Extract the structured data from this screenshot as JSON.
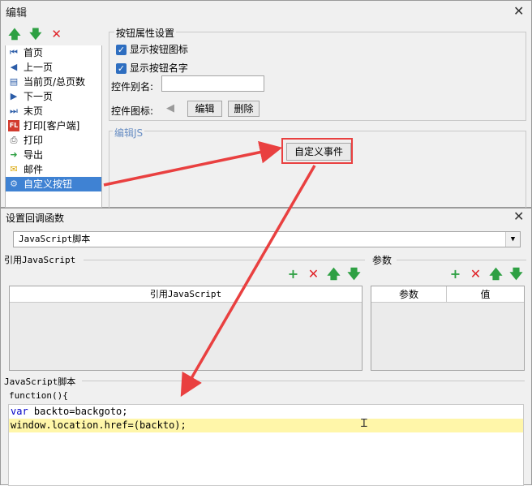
{
  "edit_dialog": {
    "title": "编辑",
    "toolbar": {
      "icons": [
        "add-up-icon",
        "move-down-icon",
        "delete-icon"
      ]
    },
    "button_list": [
      {
        "label": "首页",
        "icon": "first-page-icon"
      },
      {
        "label": "上一页",
        "icon": "prev-page-icon"
      },
      {
        "label": "当前页/总页数",
        "icon": "page-count-icon"
      },
      {
        "label": "下一页",
        "icon": "next-page-icon"
      },
      {
        "label": "末页",
        "icon": "last-page-icon"
      },
      {
        "label": "打印[客户端]",
        "icon": "client-print-icon"
      },
      {
        "label": "打印",
        "icon": "printer-icon"
      },
      {
        "label": "导出",
        "icon": "export-icon"
      },
      {
        "label": "邮件",
        "icon": "mail-icon"
      },
      {
        "label": "自定义按钮",
        "icon": "gear-icon",
        "selected": true
      }
    ],
    "props": {
      "group_title": "按钮属性设置",
      "show_icon_label": "显示按钮图标",
      "show_name_label": "显示按钮名字",
      "alias_label": "控件别名:",
      "alias_value": "",
      "icon_label": "控件图标:",
      "edit_button": "编辑",
      "delete_button": "删除"
    },
    "js": {
      "group_title": "编辑JS",
      "custom_event_button": "自定义事件"
    }
  },
  "callback_dialog": {
    "title": "设置回调函数",
    "type_select": "JavaScript脚本",
    "ref_section": "引用JavaScript",
    "ref_column": "引用JavaScript",
    "param_section": "参数",
    "param_columns": [
      "参数",
      "值"
    ],
    "script_section": "JavaScript脚本",
    "function_header": "function(){",
    "code_lines": [
      {
        "kw": "var",
        "rest": " backto=backgoto;"
      },
      {
        "kw": "",
        "rest": "window.location.href=(backto);"
      }
    ]
  },
  "colors": {
    "accent": "#3f82d3",
    "annotation": "#e94040",
    "add": "#2ea043",
    "delete": "#e0262b",
    "line_highlight": "#fff6a9"
  }
}
